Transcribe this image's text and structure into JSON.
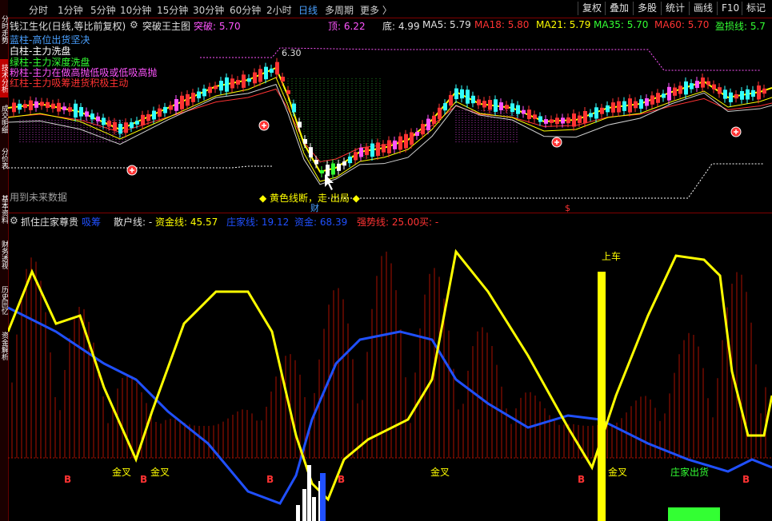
{
  "sidebar": {
    "tabs": [
      "分时走势",
      "技术分析",
      "成交明细",
      "分价表",
      "基本资料",
      "财务透视",
      "历史回忆",
      "资金解析"
    ]
  },
  "periods": [
    "分时",
    "1分钟",
    "5分钟",
    "10分钟",
    "15分钟",
    "30分钟",
    "60分钟",
    "2小时",
    "日线",
    "多周期",
    "更多 〉"
  ],
  "active_period": "日线",
  "tools": [
    "复权",
    "叠加",
    "多股",
    "统计",
    "画线",
    "F10",
    "标记"
  ],
  "main": {
    "stock_title": "钱江生化(日线,等比前复权)",
    "indicator_name": "突破王主图",
    "tupo": "突破: 5.70",
    "ding": "顶: 6.22",
    "di": "底: 4.99",
    "ma5": "MA5: 5.79",
    "ma18": "MA18: 5.80",
    "ma21": "MA21: 5.79",
    "ma35": "MA35: 5.70",
    "ma60": "MA60: 5.70",
    "yingsun": "盈损线: 5.7",
    "legend": [
      {
        "text": "蓝柱-高位出货坚决",
        "color": "#4aa0ff"
      },
      {
        "text": "白柱-主力洗盘",
        "color": "#ffffff"
      },
      {
        "text": "绿柱-主力深度洗盘",
        "color": "#33ff33"
      },
      {
        "text": "粉柱-主力在做高抛低吸或低吸高抛",
        "color": "#ff55ff"
      },
      {
        "text": "红柱-主力吸筹进货积极主动",
        "color": "#ff3333"
      }
    ],
    "future_text": "用到未来数据",
    "high_label": "6.30",
    "yellow_break": "◆ 黄色线断，走 出局 ◆",
    "cai_label": "财",
    "s_label": "$"
  },
  "sub": {
    "indicator_name": "抓住庄家尊贵",
    "xi_chou": "吸筹",
    "sanhu": "散户线: -",
    "zijin": "资金线: 45.57",
    "zhuangjia": "庄家线: 19.12",
    "zijin2": "资金: 68.39",
    "qiangshi": "强势线: 25.00",
    "mai": "买: -",
    "shangche": "上车",
    "jincha_labels": [
      "金叉",
      "金叉",
      "金叉",
      "金叉"
    ],
    "b_label": "B",
    "zhuang_chuhuo": "庄家出货"
  },
  "colors": {
    "up": "#ff3333",
    "down": "#33ffff",
    "yellow": "#ffff00",
    "blue": "#2050ff",
    "green": "#33ff33",
    "magenta": "#ff55ff",
    "bg": "#000000"
  }
}
